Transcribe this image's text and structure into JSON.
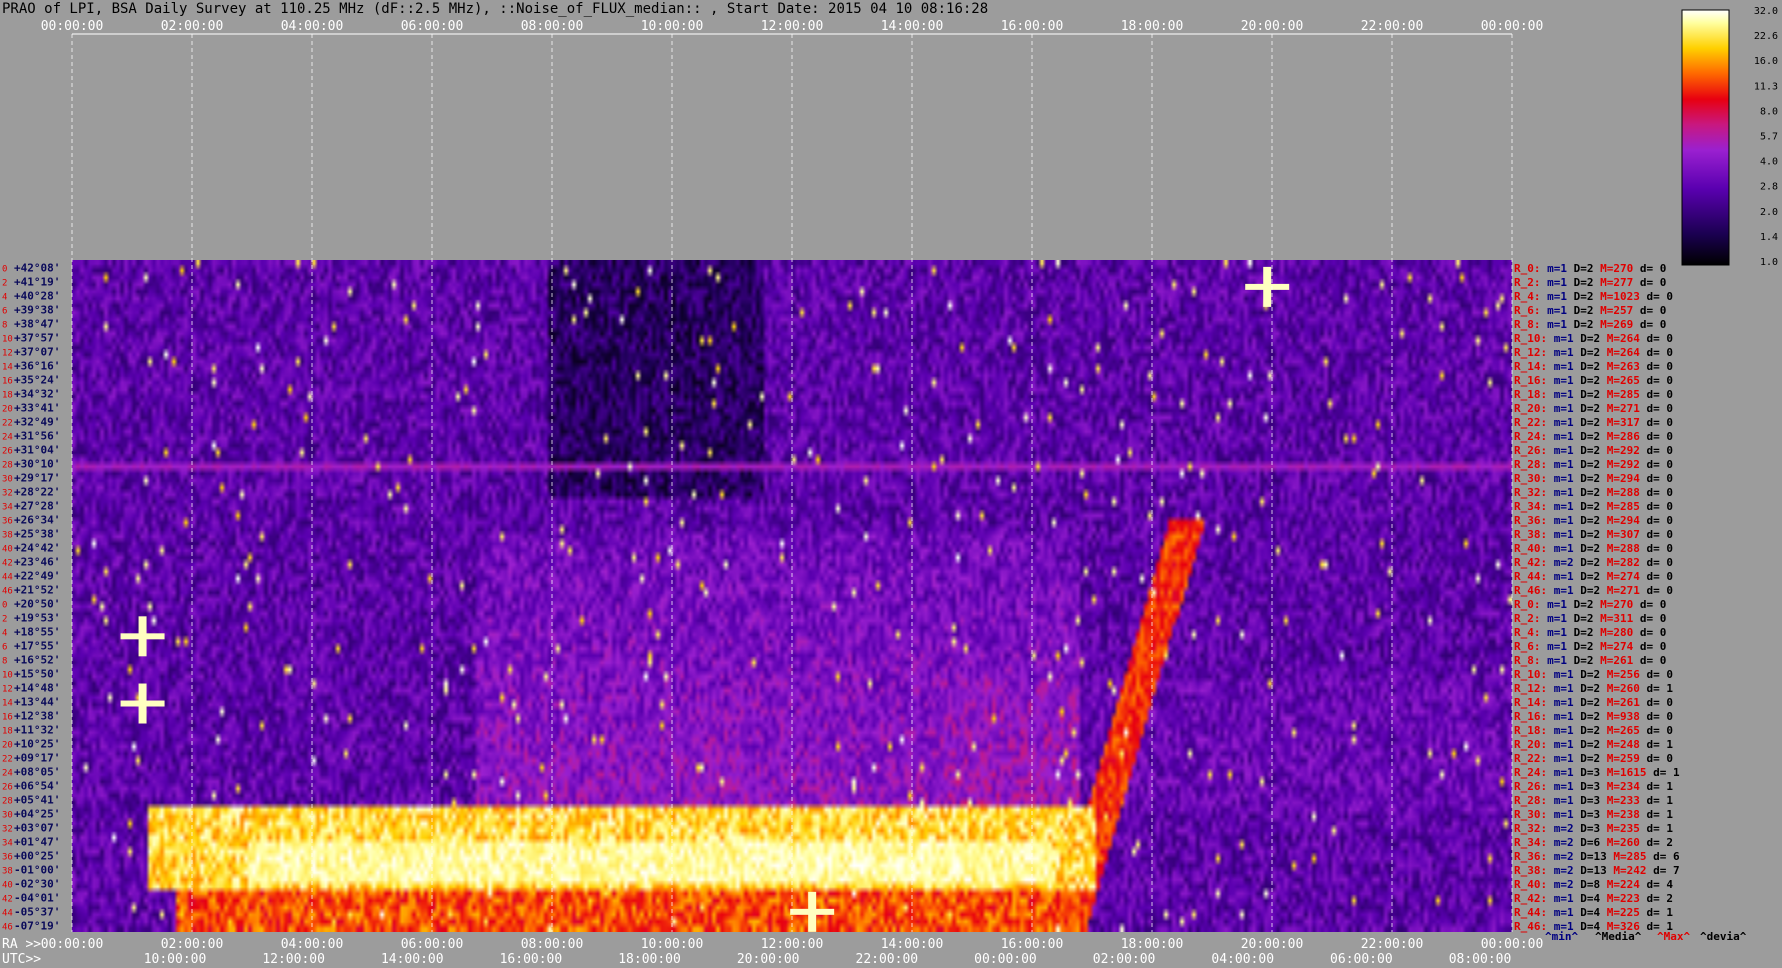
{
  "title": "PRAO of LPI, BSA Daily Survey at 110.25 MHz (dF::2.5 MHz), ::Noise_of_FLUX_median:: , Start Date: 2015 04 10 08:16:28",
  "chart_data": {
    "type": "heatmap",
    "title": "PRAO of LPI, BSA Daily Survey at 110.25 MHz (dF::2.5 MHz), ::Noise_of_FLUX_median:: , Start Date: 2015 04 10 08:16:28",
    "ra_axis_label": "RA >>",
    "utc_axis_label": "UTC>>",
    "ra_ticks": [
      "00:00:00",
      "02:00:00",
      "04:00:00",
      "06:00:00",
      "08:00:00",
      "10:00:00",
      "12:00:00",
      "14:00:00",
      "16:00:00",
      "18:00:00",
      "20:00:00",
      "22:00:00",
      "00:00:00"
    ],
    "utc_ticks": [
      "10:00:00",
      "12:00:00",
      "14:00:00",
      "16:00:00",
      "18:00:00",
      "20:00:00",
      "22:00:00",
      "00:00:00",
      "02:00:00",
      "04:00:00",
      "06:00:00",
      "08:00:00"
    ],
    "row_numbers": [
      "0",
      "2",
      "4",
      "6",
      "8",
      "10",
      "12",
      "14",
      "16",
      "18",
      "20",
      "22",
      "24",
      "26",
      "28",
      "30",
      "32",
      "34",
      "36",
      "38",
      "40",
      "42",
      "44",
      "46",
      "0",
      "2",
      "4",
      "6",
      "8",
      "10",
      "12",
      "14",
      "16",
      "18",
      "20",
      "22",
      "24",
      "26",
      "28",
      "30",
      "32",
      "34",
      "36",
      "38",
      "40",
      "42",
      "44",
      "46"
    ],
    "declinations": [
      "+42°08'",
      "+41°19'",
      "+40°28'",
      "+39°38'",
      "+38°47'",
      "+37°57'",
      "+37°07'",
      "+36°16'",
      "+35°24'",
      "+34°32'",
      "+33°41'",
      "+32°49'",
      "+31°56'",
      "+31°04'",
      "+30°10'",
      "+29°17'",
      "+28°22'",
      "+27°28'",
      "+26°34'",
      "+25°38'",
      "+24°42'",
      "+23°46'",
      "+22°49'",
      "+21°52'",
      "+20°50'",
      "+19°53'",
      "+18°55'",
      "+17°55'",
      "+16°52'",
      "+15°50'",
      "+14°48'",
      "+13°44'",
      "+12°38'",
      "+11°32'",
      "+10°25'",
      "+09°17'",
      "+08°05'",
      "+06°54'",
      "+05°41'",
      "+04°25'",
      "+03°07'",
      "+01°47'",
      "+00°25'",
      "-01°00'",
      "-02°30'",
      "-04°01'",
      "-05°37'",
      "-07°19'"
    ],
    "colorbar": {
      "labels": [
        "32.0",
        "22.6",
        "16.0",
        "11.3",
        "8.0",
        "5.7",
        "4.0",
        "2.8",
        "2.0",
        "1.4",
        "1.0"
      ],
      "min": 1.0,
      "max": 32.0,
      "scale": "log"
    },
    "row_stats": [
      {
        "beam": "R_0:",
        "m": "m=1",
        "d": "D=2",
        "max": "M=270",
        "dev": "d= 0"
      },
      {
        "beam": "R_2:",
        "m": "m=1",
        "d": "D=2",
        "max": "M=277",
        "dev": "d= 0"
      },
      {
        "beam": "R_4:",
        "m": "m=1",
        "d": "D=2",
        "max": "M=1023",
        "dev": "d= 0"
      },
      {
        "beam": "R_6:",
        "m": "m=1",
        "d": "D=2",
        "max": "M=257",
        "dev": "d= 0"
      },
      {
        "beam": "R_8:",
        "m": "m=1",
        "d": "D=2",
        "max": "M=269",
        "dev": "d= 0"
      },
      {
        "beam": "R_10:",
        "m": "m=1",
        "d": "D=2",
        "max": "M=264",
        "dev": "d= 0"
      },
      {
        "beam": "R_12:",
        "m": "m=1",
        "d": "D=2",
        "max": "M=264",
        "dev": "d= 0"
      },
      {
        "beam": "R_14:",
        "m": "m=1",
        "d": "D=2",
        "max": "M=263",
        "dev": "d= 0"
      },
      {
        "beam": "R_16:",
        "m": "m=1",
        "d": "D=2",
        "max": "M=265",
        "dev": "d= 0"
      },
      {
        "beam": "R_18:",
        "m": "m=1",
        "d": "D=2",
        "max": "M=285",
        "dev": "d= 0"
      },
      {
        "beam": "R_20:",
        "m": "m=1",
        "d": "D=2",
        "max": "M=271",
        "dev": "d= 0"
      },
      {
        "beam": "R_22:",
        "m": "m=1",
        "d": "D=2",
        "max": "M=317",
        "dev": "d= 0"
      },
      {
        "beam": "R_24:",
        "m": "m=1",
        "d": "D=2",
        "max": "M=286",
        "dev": "d= 0"
      },
      {
        "beam": "R_26:",
        "m": "m=1",
        "d": "D=2",
        "max": "M=292",
        "dev": "d= 0"
      },
      {
        "beam": "R_28:",
        "m": "m=1",
        "d": "D=2",
        "max": "M=292",
        "dev": "d= 0"
      },
      {
        "beam": "R_30:",
        "m": "m=1",
        "d": "D=2",
        "max": "M=294",
        "dev": "d= 0"
      },
      {
        "beam": "R_32:",
        "m": "m=1",
        "d": "D=2",
        "max": "M=288",
        "dev": "d= 0"
      },
      {
        "beam": "R_34:",
        "m": "m=1",
        "d": "D=2",
        "max": "M=285",
        "dev": "d= 0"
      },
      {
        "beam": "R_36:",
        "m": "m=1",
        "d": "D=2",
        "max": "M=294",
        "dev": "d= 0"
      },
      {
        "beam": "R_38:",
        "m": "m=1",
        "d": "D=2",
        "max": "M=307",
        "dev": "d= 0"
      },
      {
        "beam": "R_40:",
        "m": "m=1",
        "d": "D=2",
        "max": "M=288",
        "dev": "d= 0"
      },
      {
        "beam": "R_42:",
        "m": "m=2",
        "d": "D=2",
        "max": "M=282",
        "dev": "d= 0"
      },
      {
        "beam": "R_44:",
        "m": "m=1",
        "d": "D=2",
        "max": "M=274",
        "dev": "d= 0"
      },
      {
        "beam": "R_46:",
        "m": "m=1",
        "d": "D=2",
        "max": "M=271",
        "dev": "d= 0"
      },
      {
        "beam": "R_0:",
        "m": "m=1",
        "d": "D=2",
        "max": "M=270",
        "dev": "d= 0"
      },
      {
        "beam": "R_2:",
        "m": "m=1",
        "d": "D=2",
        "max": "M=311",
        "dev": "d= 0"
      },
      {
        "beam": "R_4:",
        "m": "m=1",
        "d": "D=2",
        "max": "M=280",
        "dev": "d= 0"
      },
      {
        "beam": "R_6:",
        "m": "m=1",
        "d": "D=2",
        "max": "M=274",
        "dev": "d= 0"
      },
      {
        "beam": "R_8:",
        "m": "m=1",
        "d": "D=2",
        "max": "M=261",
        "dev": "d= 0"
      },
      {
        "beam": "R_10:",
        "m": "m=1",
        "d": "D=2",
        "max": "M=256",
        "dev": "d= 0"
      },
      {
        "beam": "R_12:",
        "m": "m=1",
        "d": "D=2",
        "max": "M=260",
        "dev": "d= 1"
      },
      {
        "beam": "R_14:",
        "m": "m=1",
        "d": "D=2",
        "max": "M=261",
        "dev": "d= 0"
      },
      {
        "beam": "R_16:",
        "m": "m=1",
        "d": "D=2",
        "max": "M=938",
        "dev": "d= 0"
      },
      {
        "beam": "R_18:",
        "m": "m=1",
        "d": "D=2",
        "max": "M=265",
        "dev": "d= 0"
      },
      {
        "beam": "R_20:",
        "m": "m=1",
        "d": "D=2",
        "max": "M=248",
        "dev": "d= 1"
      },
      {
        "beam": "R_22:",
        "m": "m=1",
        "d": "D=2",
        "max": "M=259",
        "dev": "d= 0"
      },
      {
        "beam": "R_24:",
        "m": "m=1",
        "d": "D=3",
        "max": "M=1615",
        "dev": "d= 1"
      },
      {
        "beam": "R_26:",
        "m": "m=1",
        "d": "D=3",
        "max": "M=234",
        "dev": "d= 1"
      },
      {
        "beam": "R_28:",
        "m": "m=1",
        "d": "D=3",
        "max": "M=233",
        "dev": "d= 1"
      },
      {
        "beam": "R_30:",
        "m": "m=1",
        "d": "D=3",
        "max": "M=238",
        "dev": "d= 1"
      },
      {
        "beam": "R_32:",
        "m": "m=2",
        "d": "D=3",
        "max": "M=235",
        "dev": "d= 1"
      },
      {
        "beam": "R_34:",
        "m": "m=2",
        "d": "D=6",
        "max": "M=260",
        "dev": "d= 2"
      },
      {
        "beam": "R_36:",
        "m": "m=2",
        "d": "D=13",
        "max": "M=285",
        "dev": "d= 6"
      },
      {
        "beam": "R_38:",
        "m": "m=2",
        "d": "D=13",
        "max": "M=242",
        "dev": "d= 7"
      },
      {
        "beam": "R_40:",
        "m": "m=2",
        "d": "D=8",
        "max": "M=224",
        "dev": "d= 4"
      },
      {
        "beam": "R_42:",
        "m": "m=1",
        "d": "D=4",
        "max": "M=223",
        "dev": "d= 2"
      },
      {
        "beam": "R_44:",
        "m": "m=1",
        "d": "D=4",
        "max": "M=225",
        "dev": "d= 1"
      },
      {
        "beam": "R_46:",
        "m": "m=1",
        "d": "D=4",
        "max": "M=326",
        "dev": "d= 1"
      }
    ],
    "stats_legend": [
      "^min^",
      "^Media^",
      "^Max^",
      "^devia^"
    ]
  },
  "colors": {
    "background": "#9c9c9c",
    "row_label_red": "#e00000",
    "stats_blue": "#000080",
    "stats_red": "#e00000"
  }
}
